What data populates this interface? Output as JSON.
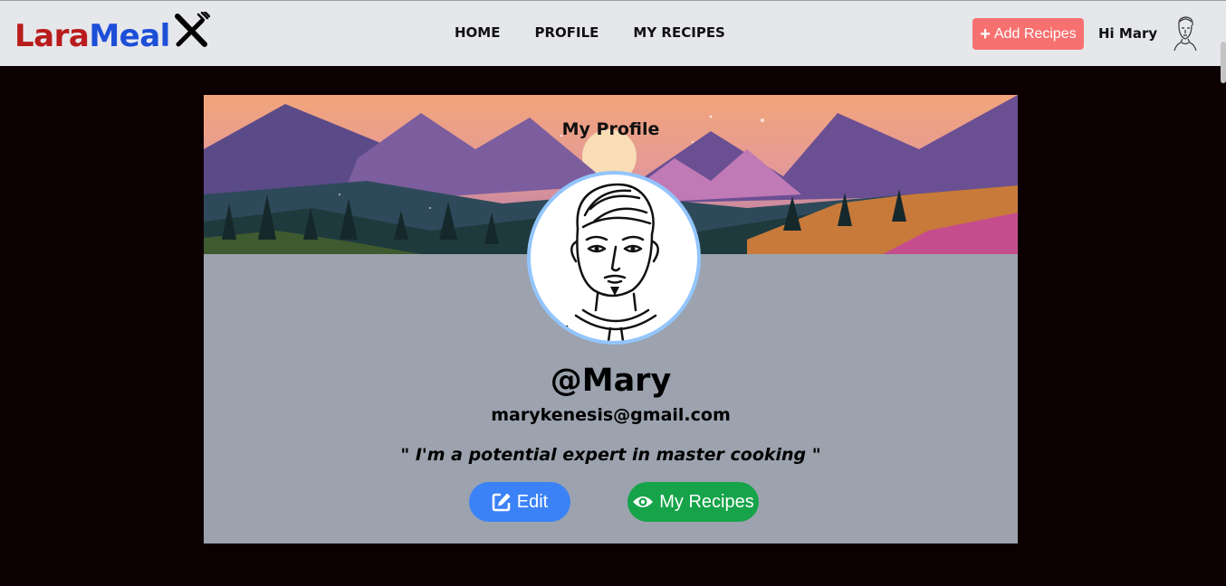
{
  "brand": {
    "part1": "Lara",
    "part2": "Meal",
    "logo_icon": "fork-knife-icon"
  },
  "nav": {
    "links": [
      "HOME",
      "PROFILE",
      "MY RECIPES"
    ]
  },
  "header": {
    "add_button_label": "Add Recipes",
    "add_icon": "plus-icon",
    "greeting": "Hi Mary",
    "avatar_icon": "user-avatar-sketch"
  },
  "profile": {
    "title": "My Profile",
    "username": "@Mary",
    "email": "marykenesis@gmail.com",
    "bio": "\" I'm a potential expert in master cooking \"",
    "edit_label": "Edit",
    "edit_icon": "edit-icon",
    "recipes_label": "My Recipes",
    "recipes_icon": "eye-icon"
  },
  "colors": {
    "brand_red": "#b91c1c",
    "brand_blue": "#1d4ed8",
    "add_button": "#f87171",
    "edit_button": "#3b82f6",
    "recipes_button": "#16a34a",
    "avatar_ring": "#93c5fd",
    "page_bg": "#0d0002",
    "card_bg": "#9ca3af"
  }
}
